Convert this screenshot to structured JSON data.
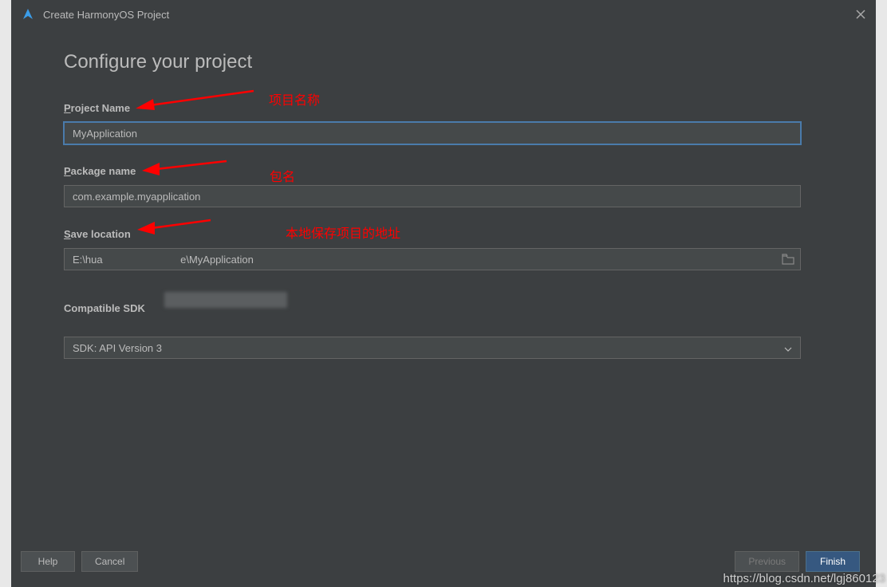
{
  "window": {
    "title": "Create HarmonyOS Project"
  },
  "heading": "Configure your project",
  "fields": {
    "projectName": {
      "label": "Project Name",
      "value": "MyApplication"
    },
    "packageName": {
      "label": "Package name",
      "value": "com.example.myapplication"
    },
    "saveLocation": {
      "label": "Save location",
      "value_prefix": "E:\\hua",
      "value_suffix": "e\\MyApplication"
    },
    "compatibleSdk": {
      "label": "Compatible SDK",
      "value": "SDK: API Version 3"
    }
  },
  "annotations": {
    "projectName": "项目名称",
    "packageName": "包名",
    "saveLocation": "本地保存项目的地址"
  },
  "buttons": {
    "help": "Help",
    "cancel": "Cancel",
    "previous": "Previous",
    "finish": "Finish"
  },
  "watermark": "https://blog.csdn.net/lgj860123"
}
